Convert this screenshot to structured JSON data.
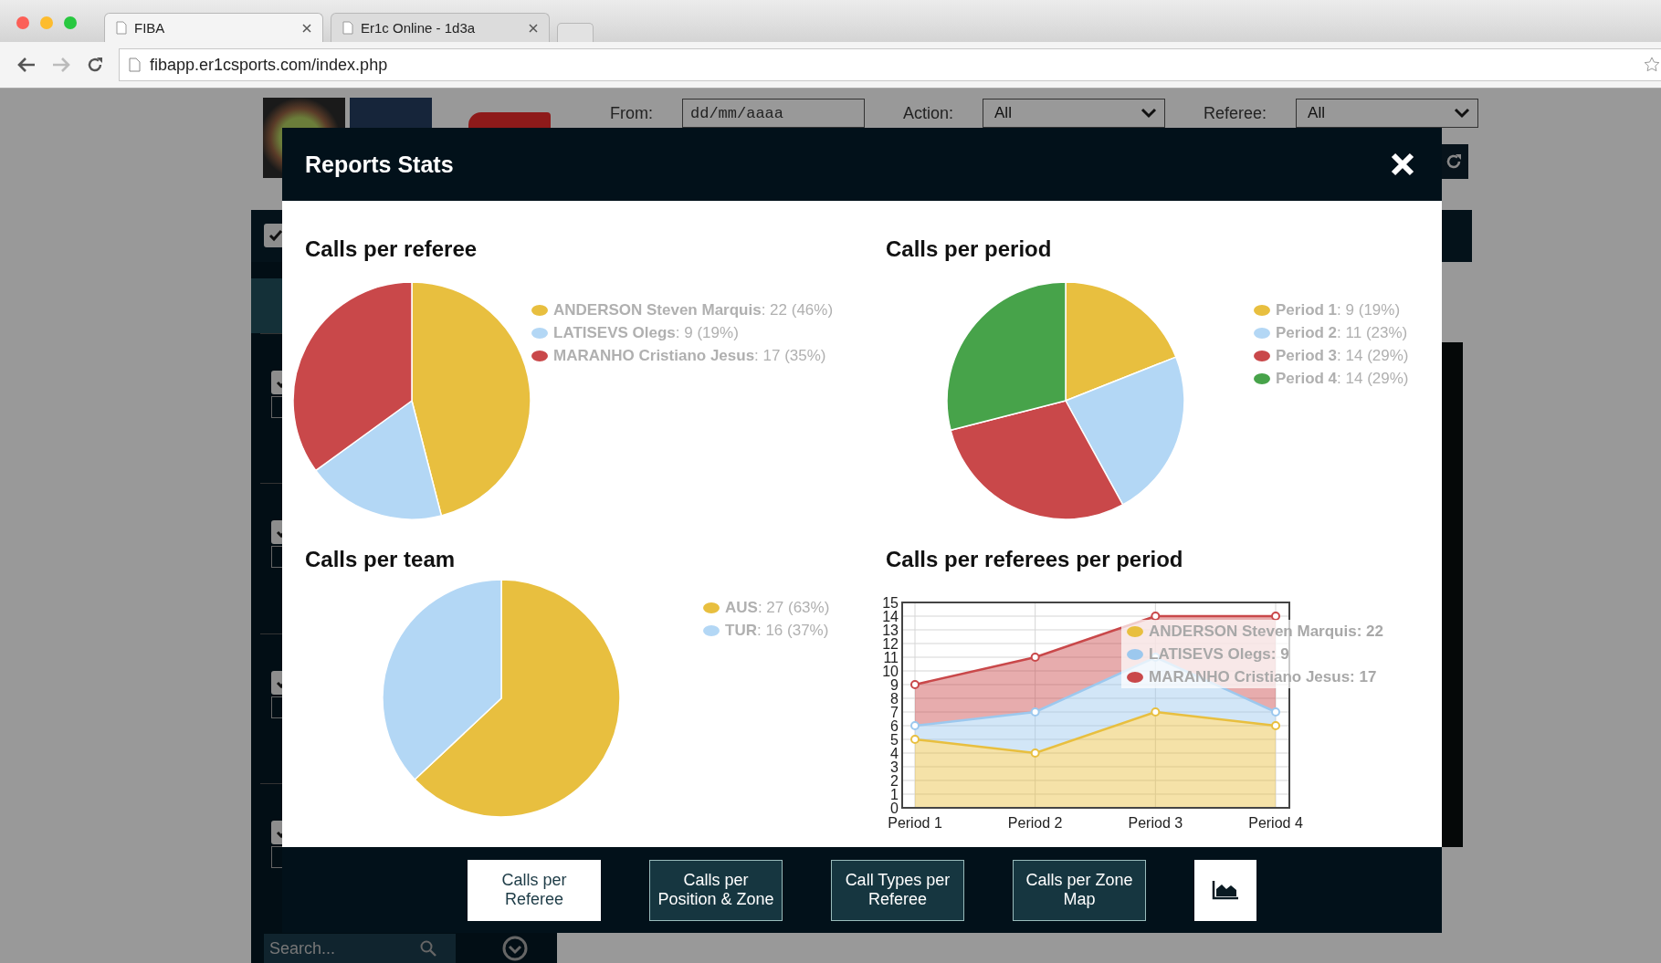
{
  "browser": {
    "tabs": [
      {
        "title": "FIBA",
        "selected": true
      },
      {
        "title": "Er1c Online - 1d3a",
        "selected": false
      }
    ],
    "url": "fibapp.er1csports.com/index.php"
  },
  "filters": [
    {
      "label": "From:",
      "kind": "date",
      "placeholder": "dd/mm/aaaa"
    },
    {
      "label": "Action:",
      "kind": "select",
      "value": "All"
    },
    {
      "label": "Referee:",
      "kind": "select",
      "value": "All"
    }
  ],
  "side_panel": {
    "select_all": {
      "checked": true
    },
    "items": [
      {
        "checked": true
      },
      {
        "checked": true
      },
      {
        "checked": true
      },
      {
        "checked": true
      }
    ],
    "search": {
      "placeholder": "Search..."
    }
  },
  "modal": {
    "title": "Reports Stats",
    "charts": [
      {
        "chart_data": {
          "type": "pie",
          "title": "Calls per referee",
          "categories": [
            "ANDERSON Steven Marquis",
            "LATISEVS Olegs",
            "MARANHO Cristiano Jesus"
          ],
          "values": [
            46,
            19,
            35
          ]
        },
        "legend": [
          {
            "value": ": 22 (46%)",
            "color": "#e8bf3f"
          },
          {
            "value": ": 9 (19%)",
            "color": "#b3d7f5"
          },
          {
            "value": ": 17 (35%)",
            "color": "#c9484a"
          }
        ]
      },
      {
        "chart_data": {
          "type": "pie",
          "title": "Calls per period",
          "categories": [
            "Period 1",
            "Period 2",
            "Period 3",
            "Period 4"
          ],
          "values": [
            19,
            23,
            29,
            29
          ]
        },
        "legend": [
          {
            "value": ": 9 (19%)",
            "color": "#e8bf3f"
          },
          {
            "value": ": 11 (23%)",
            "color": "#b3d7f5"
          },
          {
            "value": ": 14 (29%)",
            "color": "#c9484a"
          },
          {
            "value": ": 14 (29%)",
            "color": "#47a34a"
          }
        ]
      },
      {
        "chart_data": {
          "type": "pie",
          "title": "Calls per team",
          "categories": [
            "AUS",
            "TUR"
          ],
          "values": [
            63,
            37
          ]
        },
        "legend": [
          {
            "value": ": 27 (63%)",
            "color": "#e8bf3f"
          },
          {
            "value": ": 16 (37%)",
            "color": "#b3d7f5"
          }
        ]
      },
      {
        "chart_data": {
          "type": "area",
          "title": "Calls per referees per period",
          "stacked": true,
          "grid": true,
          "categories": [
            "Period 1",
            "Period 2",
            "Period 3",
            "Period 4"
          ],
          "ylim": [
            0,
            15
          ],
          "yticks": [
            0,
            1,
            2,
            3,
            4,
            5,
            6,
            7,
            8,
            9,
            10,
            11,
            12,
            13,
            14,
            15
          ],
          "series": [
            {
              "name": "ANDERSON Steven Marquis",
              "color": "#e8bf3f",
              "values": [
                5,
                4,
                7,
                6
              ]
            },
            {
              "name": "LATISEVS Olegs",
              "color": "#9cc8ee",
              "values": [
                1,
                3,
                4,
                1
              ]
            },
            {
              "name": "MARANHO Cristiano Jesus",
              "color": "#c9484a",
              "values": [
                3,
                4,
                3,
                7
              ]
            }
          ]
        },
        "legend": [
          {
            "value": ": 22"
          },
          {
            "value": ": 9"
          },
          {
            "value": ": 17"
          }
        ]
      }
    ],
    "buttons": [
      {
        "kind": "text",
        "label": "Calls per Referee",
        "selected": true
      },
      {
        "kind": "text",
        "label": "Calls per Position & Zone",
        "selected": false
      },
      {
        "kind": "text",
        "label": "Call Types per Referee",
        "selected": false
      },
      {
        "kind": "text",
        "label": "Calls per Zone Map",
        "selected": false
      },
      {
        "kind": "icon",
        "selected": false
      }
    ]
  }
}
